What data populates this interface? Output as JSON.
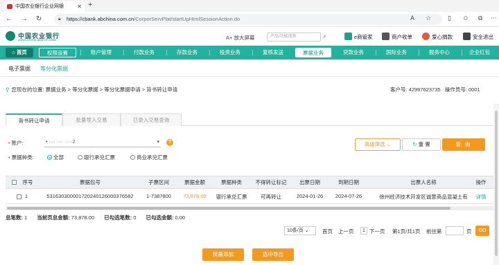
{
  "browser": {
    "tab_title": "中国农业银行企业网银",
    "new_tab": "+",
    "url_domain": "https://cbank.abchina.com.cn",
    "url_path": "/CorporServPlat/startUpHtmlSessionAction.do"
  },
  "header": {
    "logo_cn": "中国农业银行",
    "logo_en": "AGRICULTURAL BANK OF CHINA",
    "font_zoom": "A+ 放大屏幕",
    "search_placeholder": "产品/功能搜索",
    "links": [
      "e商管家",
      "商户收单",
      "爱心捐款",
      "安全退出"
    ],
    "link_colors": [
      "#1aa28f",
      "#555555",
      "#e05a3a",
      "#444444"
    ]
  },
  "main_nav": {
    "items": [
      "首页",
      "权限设置",
      "账户管理",
      "付款业务",
      "存款业务",
      "投资业务",
      "复核发送",
      "票据业务",
      "贷款业务",
      "国际业务",
      "服务中心",
      "企业红包"
    ],
    "active_index": 7,
    "home_index": 0,
    "highlight_index": 1
  },
  "sub_nav": {
    "items": [
      "电子票据",
      "等分化票据"
    ],
    "active_index": 1
  },
  "breadcrumb": {
    "text": "您现在的位置: 票据业务 > 等分化票据 > 等分化票据申请 > 背书转让申请",
    "customer_no": "客户号: 42997623735",
    "operator_no": "操作员号: 0001"
  },
  "page_tabs": [
    "背书转让申请",
    "批量导入交易",
    "已录入交易查询"
  ],
  "filter": {
    "account_label": "账户:",
    "account_value": "• ···· ···· ·····2",
    "type_label": "票据种类:",
    "radio_options": [
      "全部",
      "银行承兑汇票",
      "商业承兑汇票"
    ],
    "radio_selected": 0,
    "advanced_label": "高级筛选 ⌄",
    "reset_label": "重 置",
    "query_label": "查 询"
  },
  "table": {
    "headers": [
      "序号",
      "票据包号",
      "子票区间",
      "票据金额",
      "票据种类",
      "不得转让标记",
      "出票日期",
      "到期日期",
      "出票人名称",
      "操作"
    ],
    "rows": [
      {
        "index": "1",
        "bill_no": "531630300001720240126000376582",
        "range": "1-7387800",
        "amount": "73,878.00",
        "type": "银行承兑汇票",
        "transfer_flag": "可再转让",
        "issue_date": "2024-01-26",
        "due_date": "2024-07-26",
        "drawer": "徐州经济技术开发区诚意商品混凝土有",
        "action": "详情"
      }
    ]
  },
  "summary": {
    "total_label": "总笔数:",
    "total_value": "1",
    "page_amount_label": "当前页总金额:",
    "page_amount_value": "73,878.00",
    "selected_count_label": "已勾选笔数:",
    "selected_count_value": "0",
    "selected_amount_label": "已勾选金额:",
    "selected_amount_value": "0.00"
  },
  "pagination": {
    "page_size": "10条/页 ⌄",
    "first": "首页",
    "prev": "上一页",
    "current": "1",
    "next": "下一页",
    "info": "第1页/共1页",
    "goto_label": "前往第",
    "page_unit": "页",
    "go": "GO"
  },
  "actions": {
    "batch_add": "批量添加",
    "export_selected": "选中导出"
  },
  "colors": {
    "brand": "#23b1a0",
    "accent": "#f39a1e",
    "amount": "#e8921f"
  }
}
